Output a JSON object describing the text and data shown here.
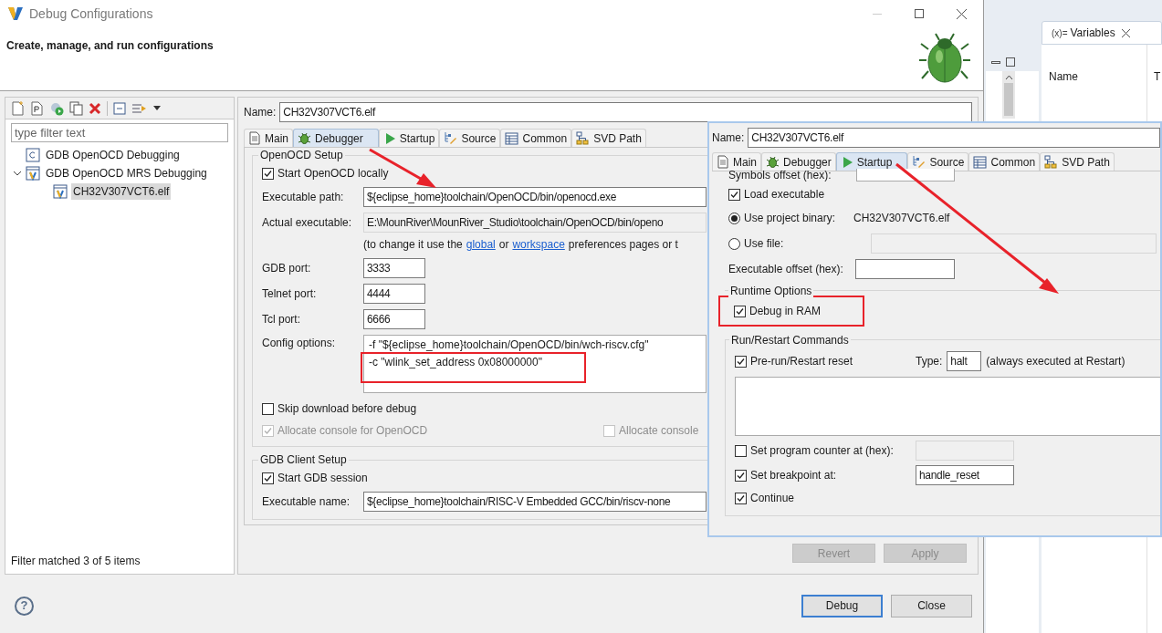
{
  "window": {
    "title": "Debug Configurations",
    "subtitle": "Create, manage, and run configurations"
  },
  "filter": {
    "placeholder": "type filter text"
  },
  "tree": [
    {
      "label": "GDB OpenOCD Debugging",
      "kind": "c",
      "selected": false
    },
    {
      "label": "GDB OpenOCD MRS Debugging",
      "kind": "v",
      "selected": false,
      "expanded": true,
      "children": [
        {
          "label": "CH32V307VCT6.elf",
          "kind": "v",
          "selected": true
        }
      ]
    }
  ],
  "filter_status": "Filter matched 3 of 5 items",
  "config": {
    "name_label": "Name:",
    "name": "CH32V307VCT6.elf",
    "tabs": [
      {
        "label": "Main",
        "selected": false
      },
      {
        "label": "Debugger",
        "selected": true
      },
      {
        "label": "Startup",
        "selected": false
      },
      {
        "label": "Source",
        "selected": false
      },
      {
        "label": "Common",
        "selected": false
      },
      {
        "label": "SVD Path",
        "selected": false
      }
    ],
    "openocd_setup": {
      "title": "OpenOCD Setup",
      "start_locally": {
        "label": "Start OpenOCD locally",
        "checked": true
      },
      "executable_path": {
        "label": "Executable path:",
        "value": "${eclipse_home}toolchain/OpenOCD/bin/openocd.exe"
      },
      "actual_executable": {
        "label": "Actual executable:",
        "value": "E:\\MounRiver\\MounRiver_Studio\\toolchain/OpenOCD/bin/openo"
      },
      "note": [
        {
          "kind": "text",
          "text": "(to change it use the"
        },
        {
          "kind": "link",
          "text": "global"
        },
        {
          "kind": "text",
          "text": "or"
        },
        {
          "kind": "link",
          "text": "workspace"
        },
        {
          "kind": "text",
          "text": "preferences pages or t"
        }
      ],
      "ports": [
        {
          "label": "GDB port:",
          "value": "3333"
        },
        {
          "label": "Telnet port:",
          "value": "4444"
        },
        {
          "label": "Tcl port:",
          "value": "6666"
        }
      ],
      "config_options": {
        "label": "Config options:",
        "lines": [
          "-f \"${eclipse_home}toolchain/OpenOCD/bin/wch-riscv.cfg\"",
          "-c \"wlink_set_address 0x08000000\""
        ]
      },
      "skip_download": {
        "label": "Skip download before debug",
        "checked": false
      },
      "allocate_console": {
        "label": "Allocate console for OpenOCD",
        "checked": true,
        "disabled": true
      },
      "allocate_console_2": {
        "label": "Allocate console",
        "checked": false,
        "disabled": true
      }
    },
    "gdb_client": {
      "title": "GDB Client Setup",
      "start_gdb": {
        "label": "Start GDB session",
        "checked": true
      },
      "executable_name": {
        "label": "Executable name:",
        "value": "${eclipse_home}toolchain/RISC-V Embedded GCC/bin/riscv-none"
      }
    },
    "panel_buttons": [
      {
        "label": "Revert",
        "disabled": true
      },
      {
        "label": "Apply",
        "disabled": true
      }
    ]
  },
  "help": "?",
  "dialog_buttons": [
    {
      "label": "Debug",
      "default": true
    },
    {
      "label": "Close",
      "default": false
    }
  ],
  "overlay": {
    "name_label": "Name:",
    "name": "CH32V307VCT6.elf",
    "tabs": [
      {
        "label": "Main",
        "selected": false
      },
      {
        "label": "Debugger",
        "selected": false
      },
      {
        "label": "Startup",
        "selected": true
      },
      {
        "label": "Source",
        "selected": false
      },
      {
        "label": "Common",
        "selected": false
      },
      {
        "label": "SVD Path",
        "selected": false
      }
    ],
    "symbols_offset_label": "Symbols offset (hex):",
    "load_executable": {
      "label": "Load executable",
      "checked": true
    },
    "binary_options": [
      {
        "label": "Use project binary:",
        "value": "CH32V307VCT6.elf",
        "selected": true
      },
      {
        "label": "Use file:",
        "selected": false
      }
    ],
    "executable_offset_label": "Executable offset (hex):",
    "runtime_options": {
      "title": "Runtime Options",
      "debug_in_ram": {
        "label": "Debug in RAM",
        "checked": true
      }
    },
    "run_restart": {
      "title": "Run/Restart Commands",
      "pre_run": {
        "label": "Pre-run/Restart reset",
        "checked": true
      },
      "type_label": "Type:",
      "type_value": "halt",
      "type_note": "(always executed at Restart)",
      "set_pc": {
        "label": "Set program counter at (hex):",
        "checked": false
      },
      "set_breakpoint": {
        "label": "Set breakpoint at:",
        "checked": true,
        "value": "handle_reset"
      },
      "continue": {
        "label": "Continue",
        "checked": true
      }
    }
  },
  "background": {
    "variables_icon": "(x)=",
    "variables_tab": "Variables",
    "column_1": "Name",
    "column_2": "T"
  }
}
